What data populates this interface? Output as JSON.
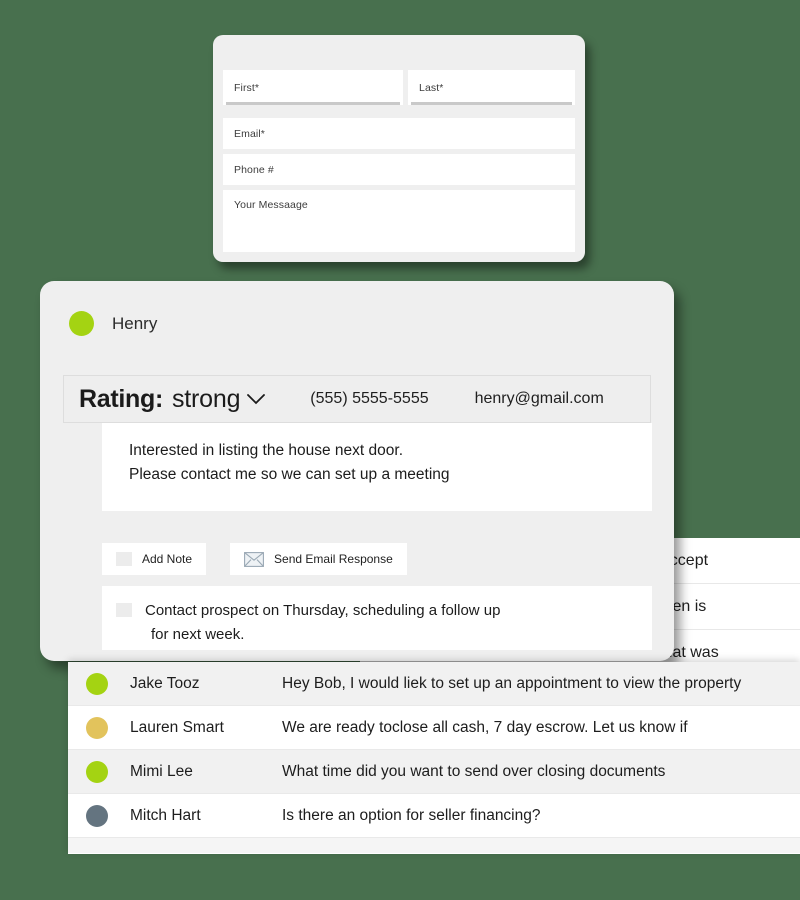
{
  "theme": {
    "background": "#48704e",
    "card_background": "#efefef",
    "accent_green": "#a4d312",
    "gold": "#e2c35c",
    "slate": "#647480"
  },
  "contact_form": {
    "fields": [
      {
        "placeholder": "First*"
      },
      {
        "placeholder": "Last*"
      },
      {
        "placeholder": "Email*"
      },
      {
        "placeholder": "Phone #"
      },
      {
        "placeholder": "Your Messaage"
      }
    ]
  },
  "arrow": {
    "icon": "arrow-down-icon"
  },
  "lead_detail": {
    "status_dot_color": "#a4d312",
    "name": "Henry",
    "rating": {
      "label": "Rating:",
      "value": "strong",
      "chevron": "chevron-down-icon"
    },
    "phone": "(555) 5555-5555",
    "email": "henry@gmail.com",
    "message_lines": [
      "Interested in listing the house next door.",
      "Please contact me so we can set up a meeting"
    ],
    "actions": [
      {
        "label": "Add Note",
        "icon": "note-icon"
      },
      {
        "label": "Send Email Response",
        "icon": "envelope-icon"
      }
    ],
    "note": {
      "icon": "note-icon",
      "line1": "Contact prospect on  Thursday, scheduling a follow up",
      "line2": "for next week."
    }
  },
  "background_table": {
    "rows": [
      {
        "text": "t accept"
      },
      {
        "text": "when is"
      },
      {
        "text": "what was"
      }
    ]
  },
  "lead_list": {
    "rows": [
      {
        "dot_color": "#a4d312",
        "name": "Jake Tooz",
        "message": "Hey Bob, I would liek to set up an appointment to view the property"
      },
      {
        "dot_color": "#e2c35c",
        "name": "Lauren  Smart",
        "message": "We are ready toclose all cash, 7 day escrow. Let us know if"
      },
      {
        "dot_color": "#a4d312",
        "name": "Mimi Lee",
        "message": "What time did you want to send over closing documents"
      },
      {
        "dot_color": "#647480",
        "name": "Mitch Hart",
        "message": "Is there an option for seller financing?"
      }
    ]
  }
}
